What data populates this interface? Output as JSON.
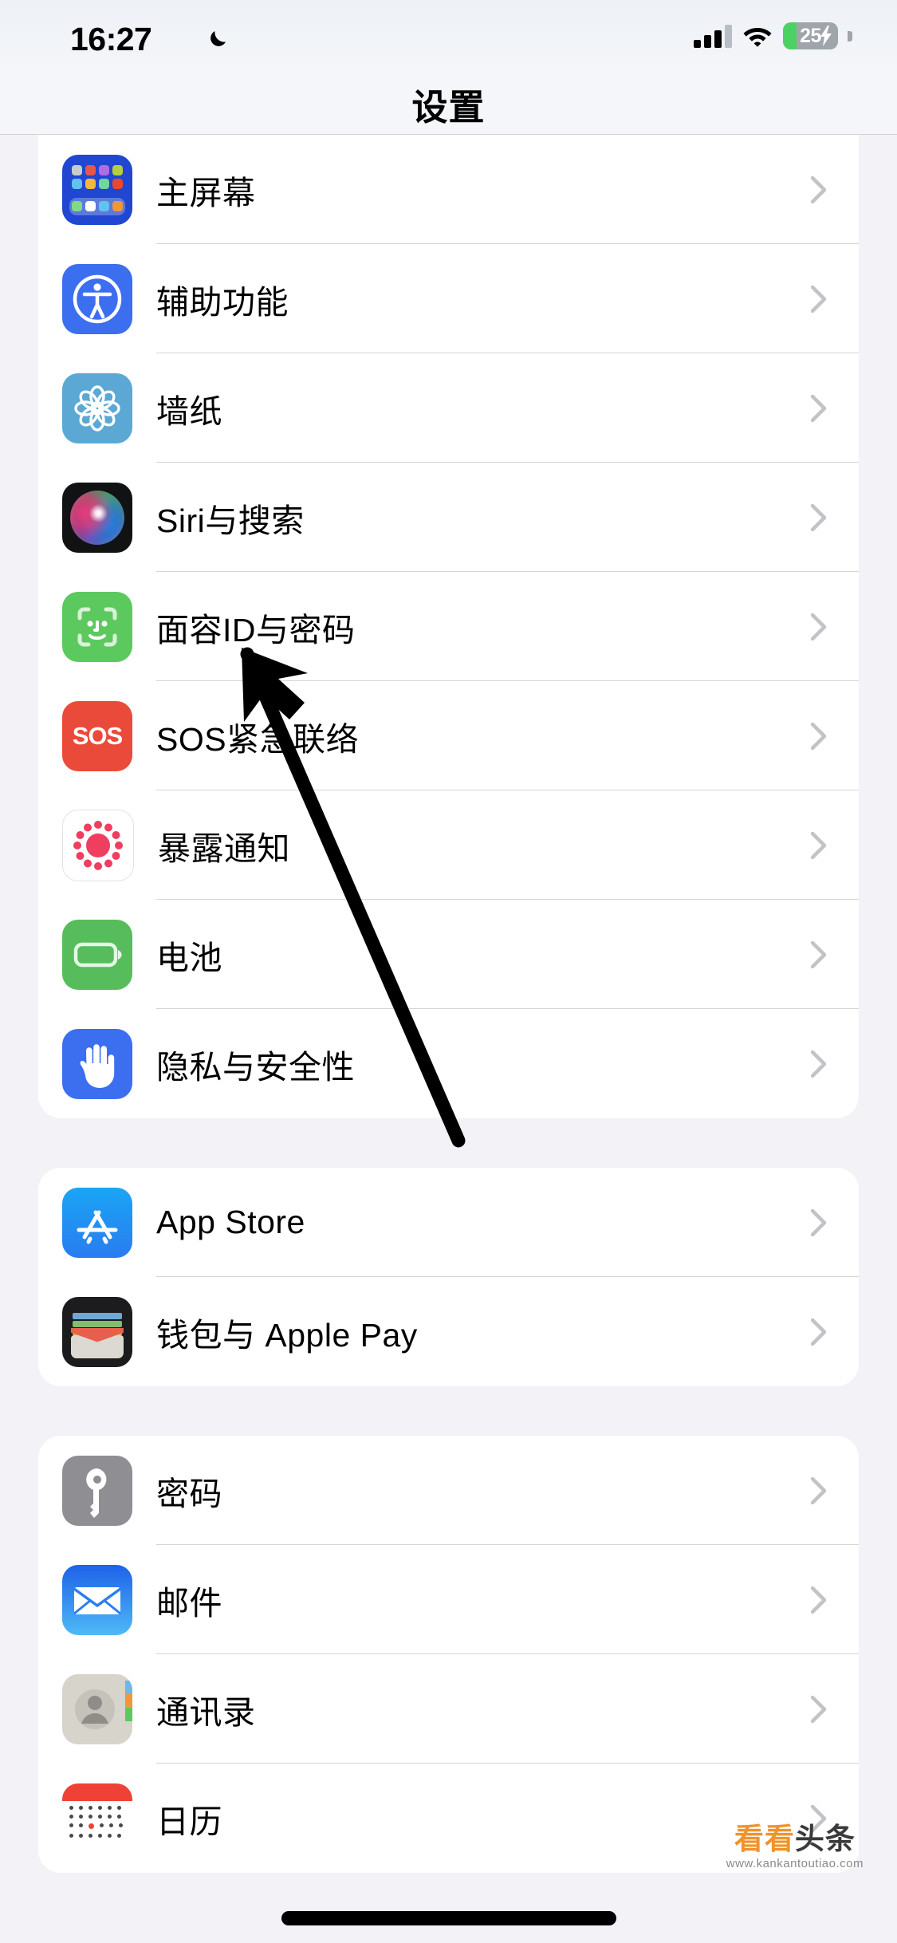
{
  "status_bar": {
    "time": "16:27",
    "dnd_icon": "moon-icon",
    "signal_icon": "cellular-signal-icon",
    "wifi_icon": "wifi-icon",
    "battery_percent": "25",
    "battery_level": 25,
    "battery_charging": true,
    "battery_fill_color": "#4cd263",
    "battery_bg_color": "#a0a4ab"
  },
  "header": {
    "title": "设置"
  },
  "groups": [
    {
      "id": "group-system",
      "rows": [
        {
          "label": "主屏幕",
          "icon": "home-screen-icon",
          "chevron": "chevron-right-icon"
        },
        {
          "label": "辅助功能",
          "icon": "accessibility-icon",
          "chevron": "chevron-right-icon"
        },
        {
          "label": "墙纸",
          "icon": "wallpaper-icon",
          "chevron": "chevron-right-icon"
        },
        {
          "label": "Siri与搜索",
          "icon": "siri-icon",
          "chevron": "chevron-right-icon"
        },
        {
          "label": "面容ID与密码",
          "icon": "face-id-icon",
          "chevron": "chevron-right-icon"
        },
        {
          "label": "SOS紧急联络",
          "icon": "sos-icon",
          "chevron": "chevron-right-icon"
        },
        {
          "label": "暴露通知",
          "icon": "exposure-notifications-icon",
          "chevron": "chevron-right-icon"
        },
        {
          "label": "电池",
          "icon": "battery-icon",
          "chevron": "chevron-right-icon"
        },
        {
          "label": "隐私与安全性",
          "icon": "privacy-hand-icon",
          "chevron": "chevron-right-icon"
        }
      ]
    },
    {
      "id": "group-store",
      "rows": [
        {
          "label": "App Store",
          "icon": "app-store-icon",
          "chevron": "chevron-right-icon"
        },
        {
          "label": "钱包与 Apple Pay",
          "icon": "wallet-icon",
          "chevron": "chevron-right-icon"
        }
      ]
    },
    {
      "id": "group-apps",
      "rows": [
        {
          "label": "密码",
          "icon": "key-icon",
          "chevron": "chevron-right-icon"
        },
        {
          "label": "邮件",
          "icon": "mail-icon",
          "chevron": "chevron-right-icon"
        },
        {
          "label": "通讯录",
          "icon": "contacts-icon",
          "chevron": "chevron-right-icon"
        },
        {
          "label": "日历",
          "icon": "calendar-icon",
          "chevron": "chevron-right-icon"
        }
      ]
    }
  ],
  "annotation": {
    "cursor_icon": "mouse-pointer-arrow",
    "points_at": "电池",
    "color": "#000000"
  },
  "watermark": {
    "brand_orange": "看看",
    "brand_dark": "头条",
    "url": "www.kankantoutiao.com"
  },
  "sos_label": "SOS",
  "icon_colors": {
    "home_screen": "#2046d2",
    "accessibility": "#3c6ef0",
    "wallpaper": "#5ba8d4",
    "siri": "#111214",
    "face_id": "#5cc95f",
    "sos": "#ea4a3a",
    "exposure": "#ffffff",
    "exposure_dot": "#ef3e5e",
    "battery": "#57bd5c",
    "privacy": "#3c6ef0",
    "app_store": "#2a7cf0",
    "wallet": "#1c1c1e",
    "passwords": "#8e8e93",
    "mail": "#2b7ef0",
    "contacts": "#d7d4cc",
    "calendar_top": "#ef4136"
  }
}
